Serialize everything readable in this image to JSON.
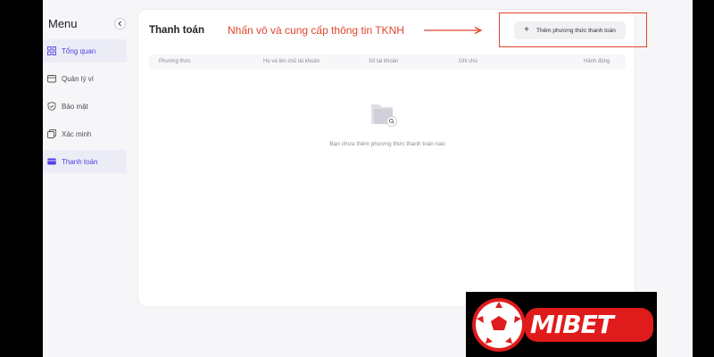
{
  "sidebar": {
    "menu_title": "Menu",
    "items": [
      {
        "label": "Tổng quan",
        "icon": "grid-icon"
      },
      {
        "label": "Quản lý ví",
        "icon": "wallet-icon"
      },
      {
        "label": "Bảo mật",
        "icon": "shield-icon"
      },
      {
        "label": "Xác minh",
        "icon": "documents-icon"
      },
      {
        "label": "Thanh toán",
        "icon": "card-icon"
      }
    ]
  },
  "main": {
    "title": "Thanh toán",
    "annotation": "Nhấn vô và cung cấp thông tin TKNH",
    "add_button_label": "Thêm phương thức thanh toán",
    "columns": [
      "Phương thức",
      "Họ và tên chủ tài khoản",
      "Số tài khoản",
      "Ghi chú",
      "Hành động"
    ],
    "empty_message": "Bạn chưa thêm phương thức thanh toán nào"
  },
  "logo": {
    "text": "MIBET"
  },
  "colors": {
    "accent": "#4f3fe0",
    "annotation": "#e0452a",
    "logo_red": "#e01b1b"
  }
}
